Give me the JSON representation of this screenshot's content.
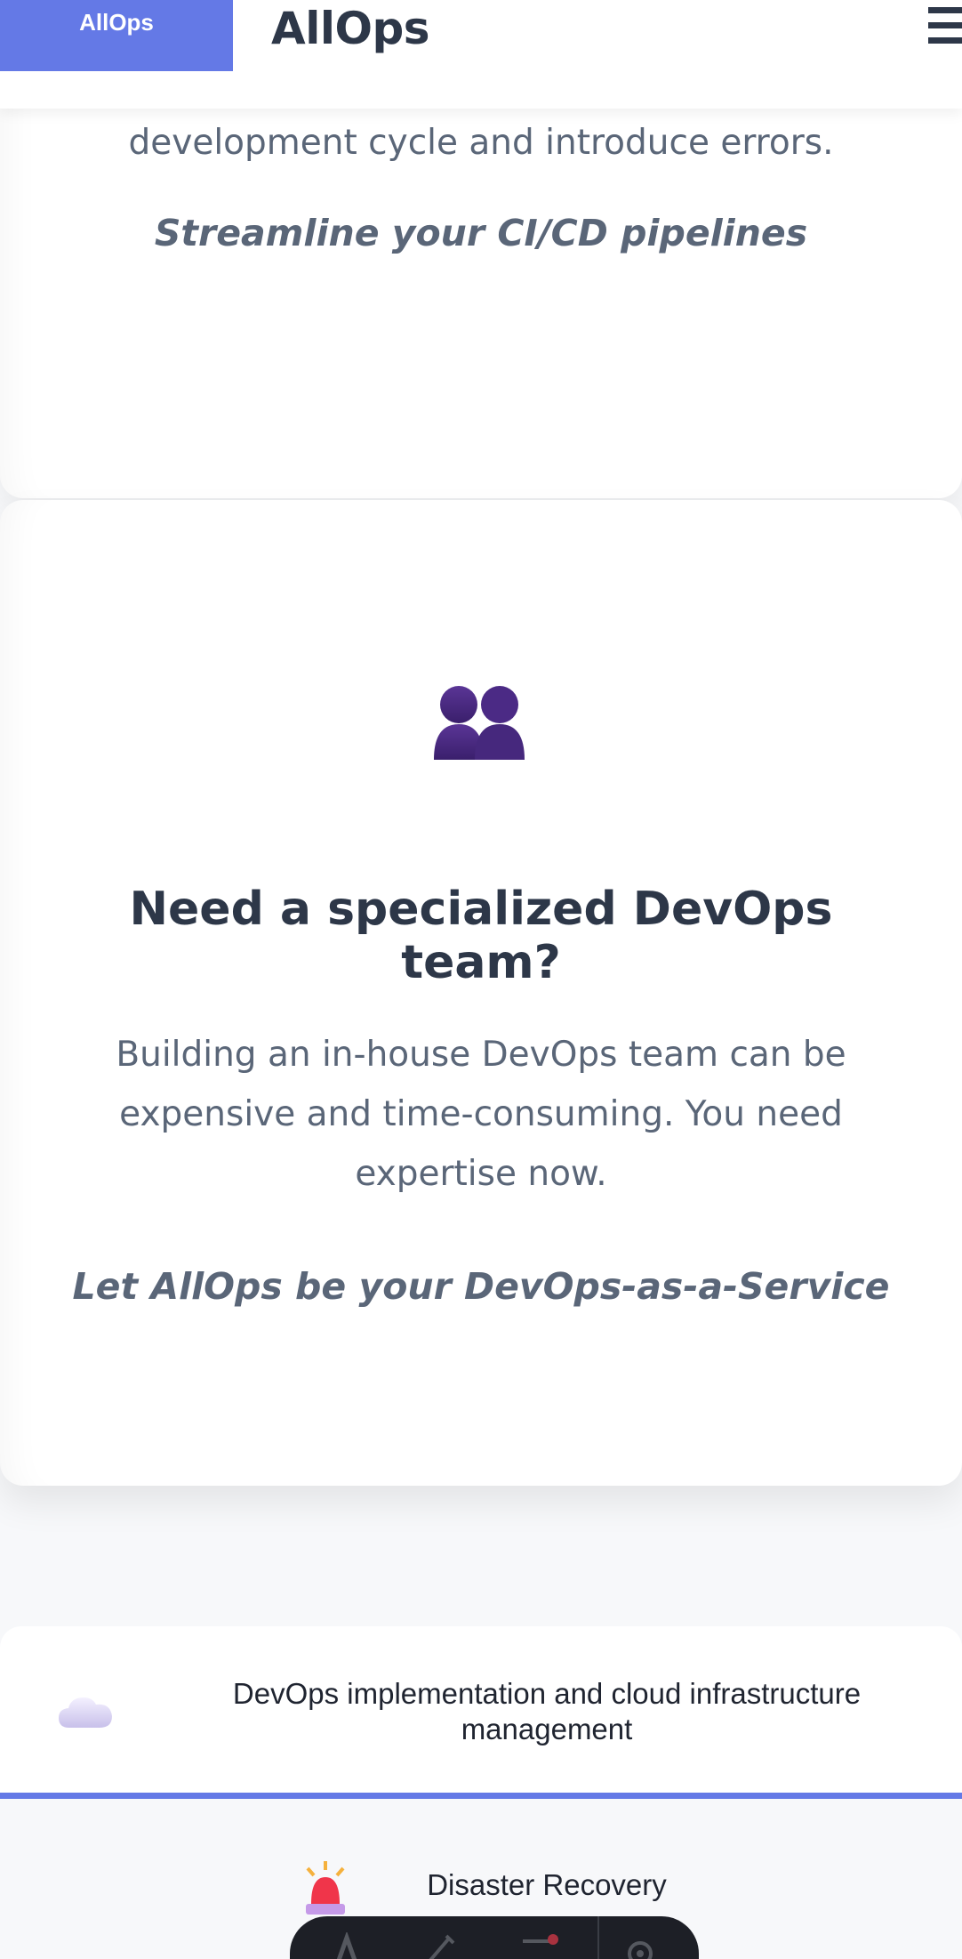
{
  "header": {
    "logo_badge": "AllOps",
    "brand_name": "AllOps",
    "menu_icon": "hamburger-menu-icon"
  },
  "card_top": {
    "body_text": "environments can slow down your development cycle and introduce errors.",
    "tagline": "Streamline your CI/CD pipelines"
  },
  "card_team": {
    "icon": "two-people-silhouette-icon",
    "title": "Need a specialized DevOps team?",
    "body_text": "Building an in-house DevOps team can be expensive and time-consuming. You need expertise now.",
    "tagline": "Let AllOps be your DevOps-as-a-Service"
  },
  "features": [
    {
      "icon": "cloud-icon",
      "label": "DevOps implementation and cloud infrastructure management"
    },
    {
      "icon": "siren-alarm-icon",
      "label": "Disaster Recovery"
    }
  ],
  "dock": {
    "items": [
      "text-icon",
      "pen-icon",
      "slider-icon",
      "settings-gear-icon"
    ]
  },
  "colors": {
    "accent": "#6479e6",
    "heading": "#2d3748",
    "body": "#5a6678",
    "background": "#f7f8fa"
  }
}
